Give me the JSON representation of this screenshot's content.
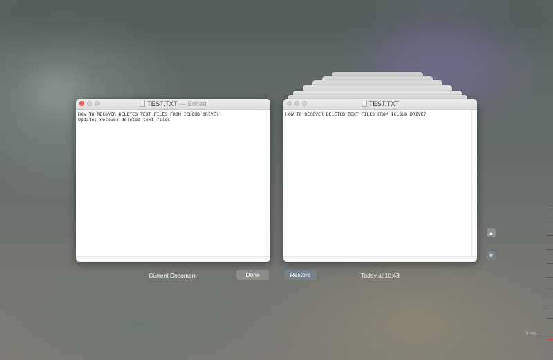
{
  "current_window": {
    "title": "TEST.TXT",
    "separator": "—",
    "status": "Edited",
    "lines": [
      "HOW TO RECOVER DELETED TEXT FILES FROM ICLOUD DRIVE?",
      "Update: recover deleted text files"
    ]
  },
  "version_window": {
    "title": "TEST.TXT",
    "lines": [
      "HOW TO RECOVER DELETED TEXT FILES FROM ICLOUD DRIVE?"
    ]
  },
  "labels": {
    "current_document": "Current Document",
    "version_timestamp": "Today at 10:43"
  },
  "buttons": {
    "done": "Done",
    "restore": "Restore"
  },
  "timeline": {
    "today": "Today"
  },
  "colors": {
    "close_button": "#fc605c",
    "timeline_marker": "#e0443e"
  },
  "icons": [
    "close-icon",
    "minimize-icon",
    "zoom-icon",
    "document-icon",
    "chevron-up-icon",
    "chevron-down-icon"
  ]
}
